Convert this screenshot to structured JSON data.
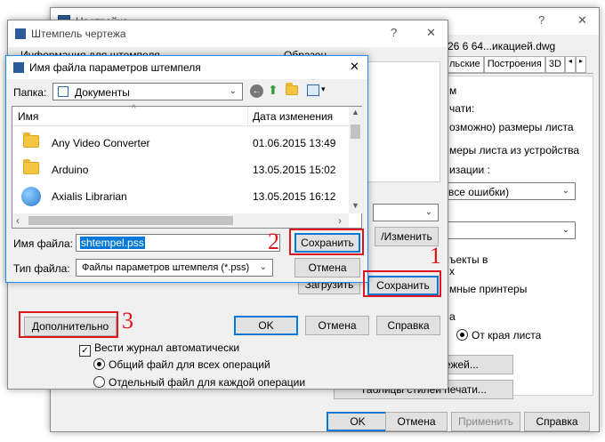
{
  "settings": {
    "title": "Настройка",
    "file_label": "26 6 64...икацией.dwg",
    "tabs": [
      "льские",
      "Построения",
      "3D"
    ],
    "lines": [
      "м",
      "чати:",
      "озможно) размеры листа",
      "меры листа из устройства",
      "изации :",
      "ъекты в",
      "х",
      "мные принтеры",
      "а"
    ],
    "combo_errors": " все ошибки)",
    "edge_radio": "От края листа",
    "stamps_button": "Штемпели чертежей...",
    "styles_button": "Таблицы стилей печати...",
    "ok": "OK",
    "cancel": "Отмена",
    "apply": "Применить",
    "help": "Справка"
  },
  "stamp": {
    "title": "Штемпель чертежа",
    "info_label": "Информация для штемпеля",
    "preview_label": "Образец",
    "add_edit": "/Изменить",
    "save": "Сохранить",
    "load": "Загрузить",
    "advanced": "Дополнительно",
    "ok": "OK",
    "cancel": "Отмена",
    "help": "Справка",
    "log_checkbox": "Вести журнал автоматически",
    "radio_common": "Общий файл для всех операций",
    "radio_separate": "Отдельный файл для каждой операции"
  },
  "saveas": {
    "title": "Имя файла параметров штемпеля",
    "folder_label": "Папка:",
    "folder_value": "Документы",
    "col_name": "Имя",
    "col_date": "Дата изменения",
    "files": [
      {
        "name": "Any Video Converter",
        "date": "01.06.2015 13:49"
      },
      {
        "name": "Arduino",
        "date": "13.05.2015 15:02"
      },
      {
        "name": "Axialis Librarian",
        "date": "13.05.2015 16:12"
      }
    ],
    "filename_label": "Имя файла:",
    "filename_value": "shtempel.pss",
    "filetype_label": "Тип файла:",
    "filetype_value": "Файлы параметров штемпеля (*.pss)",
    "save": "Сохранить",
    "cancel": "Отмена"
  },
  "annotations": [
    "1",
    "2",
    "3"
  ],
  "colors": {
    "accent": "#0078d7",
    "annotation": "#e0141e"
  }
}
